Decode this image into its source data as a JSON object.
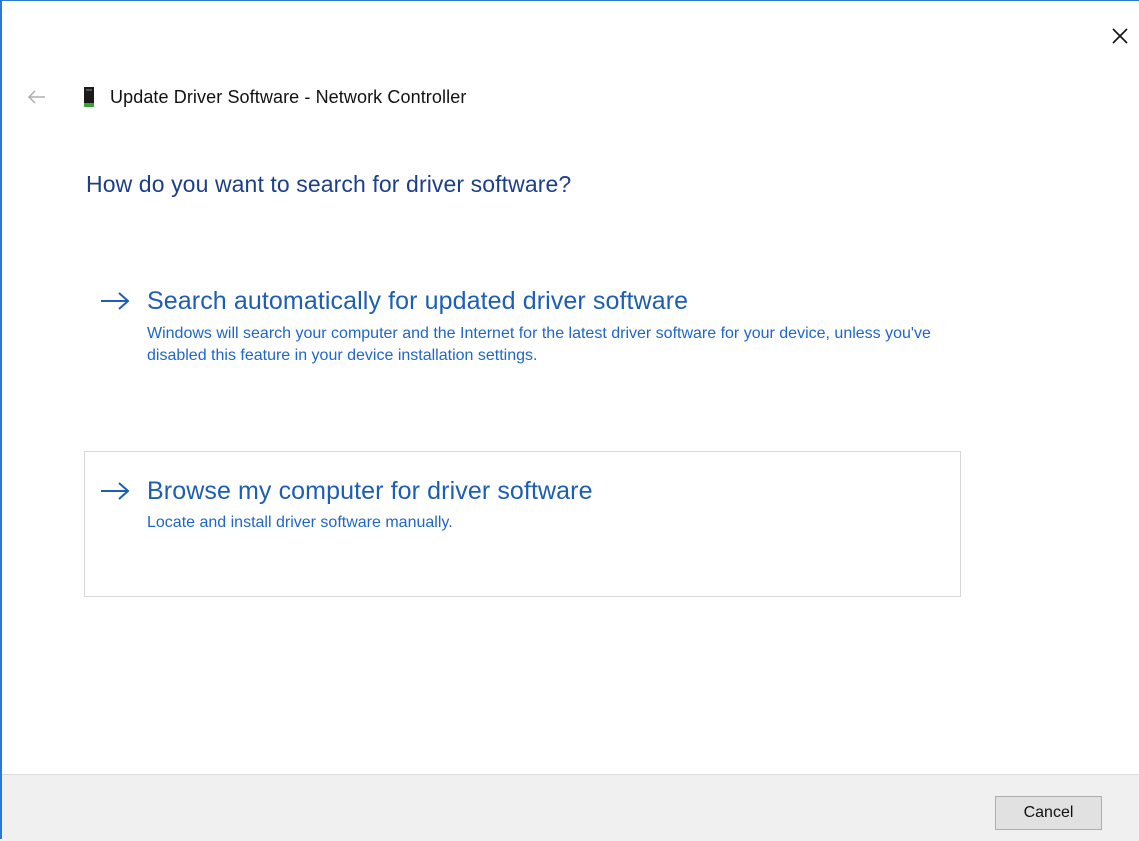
{
  "window": {
    "title": "Update Driver Software - Network Controller"
  },
  "question": "How do you want to search for driver software?",
  "options": [
    {
      "title": "Search automatically for updated driver software",
      "description": "Windows will search your computer and the Internet for the latest driver software for your device, unless you've disabled this feature in your device installation settings.",
      "icon": "arrow-right-icon"
    },
    {
      "title": "Browse my computer for driver software",
      "description": "Locate and install driver software manually.",
      "icon": "arrow-right-icon"
    }
  ],
  "footer": {
    "cancel_label": "Cancel"
  },
  "icons": {
    "close": "close-icon",
    "back": "back-arrow-icon",
    "device": "network-device-icon"
  },
  "colors": {
    "accent_border": "#2b79d4",
    "heading": "#1c3f8a",
    "link": "#1d5eb5",
    "description": "#1f66c9",
    "footer_bg": "#f0f0f0"
  }
}
